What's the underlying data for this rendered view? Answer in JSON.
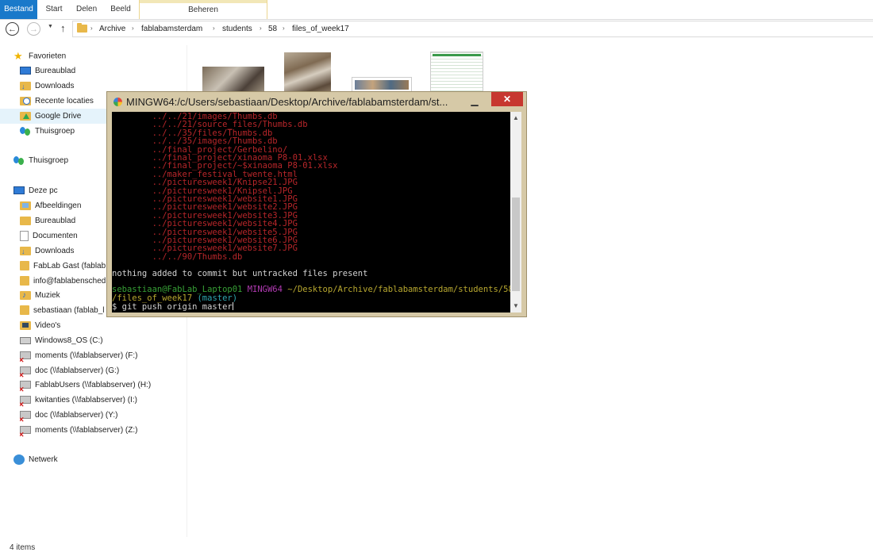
{
  "ribbon": {
    "tabs": [
      "Bestand",
      "Start",
      "Delen",
      "Beeld"
    ],
    "context_tab": "Beheren",
    "accent": "#1979ca"
  },
  "breadcrumb": [
    "Archive",
    "fablabamsterdam",
    "students",
    "58",
    "files_of_week17"
  ],
  "nav": {
    "favorites_header": "Favorieten",
    "favorites": [
      "Bureaublad",
      "Downloads",
      "Recente locaties",
      "Google Drive",
      "Thuisgroep"
    ],
    "homegroup": "Thuisgroep",
    "pc_header": "Deze pc",
    "pc_items": [
      "Afbeeldingen",
      "Bureaublad",
      "Documenten",
      "Downloads",
      "FabLab Gast (fablab",
      "info@fablabensched",
      "Muziek",
      "sebastiaan (fablab_l",
      "Video's",
      "Windows8_OS (C:)",
      "moments (\\\\fablabserver) (F:)",
      "doc (\\\\fablabserver) (G:)",
      "FablabUsers (\\\\fablabserver) (H:)",
      "kwitanties (\\\\fablabserver) (I:)",
      "doc (\\\\fablabserver) (Y:)",
      "moments (\\\\fablabserver) (Z:)"
    ],
    "network": "Netwerk"
  },
  "terminal": {
    "title": "MINGW64:/c/Users/sebastiaan/Desktop/Archive/fablabamsterdam/st...",
    "untracked": [
      "        ../../21/images/Thumbs.db",
      "        ../../21/source_files/Thumbs.db",
      "        ../../35/files/Thumbs.db",
      "        ../../35/images/Thumbs.db",
      "        ../final_project/Gerbelino/",
      "        ../final_project/xinaoma P8-01.xlsx",
      "        ../final_project/~$xinaoma P8-01.xlsx",
      "        ../maker_festival_twente.html",
      "        ../picturesweek1/Knipse21.JPG",
      "        ../picturesweek1/Knipsel.JPG",
      "        ../picturesweek1/website1.JPG",
      "        ../picturesweek1/website2.JPG",
      "        ../picturesweek1/website3.JPG",
      "        ../picturesweek1/website4.JPG",
      "        ../picturesweek1/website5.JPG",
      "        ../picturesweek1/website6.JPG",
      "        ../picturesweek1/website7.JPG",
      "        ../../90/Thumbs.db"
    ],
    "message": "nothing added to commit but untracked files present",
    "prompt_user": "sebastiaan@FabLab_Laptop01",
    "prompt_env": "MINGW64",
    "prompt_path": "~/Desktop/Archive/fablabamsterdam/students/58",
    "prompt_path_cont": "/files_of_week17",
    "prompt_branch": "(master)",
    "command": "$ git push origin master"
  },
  "status": {
    "items": "4 items"
  }
}
